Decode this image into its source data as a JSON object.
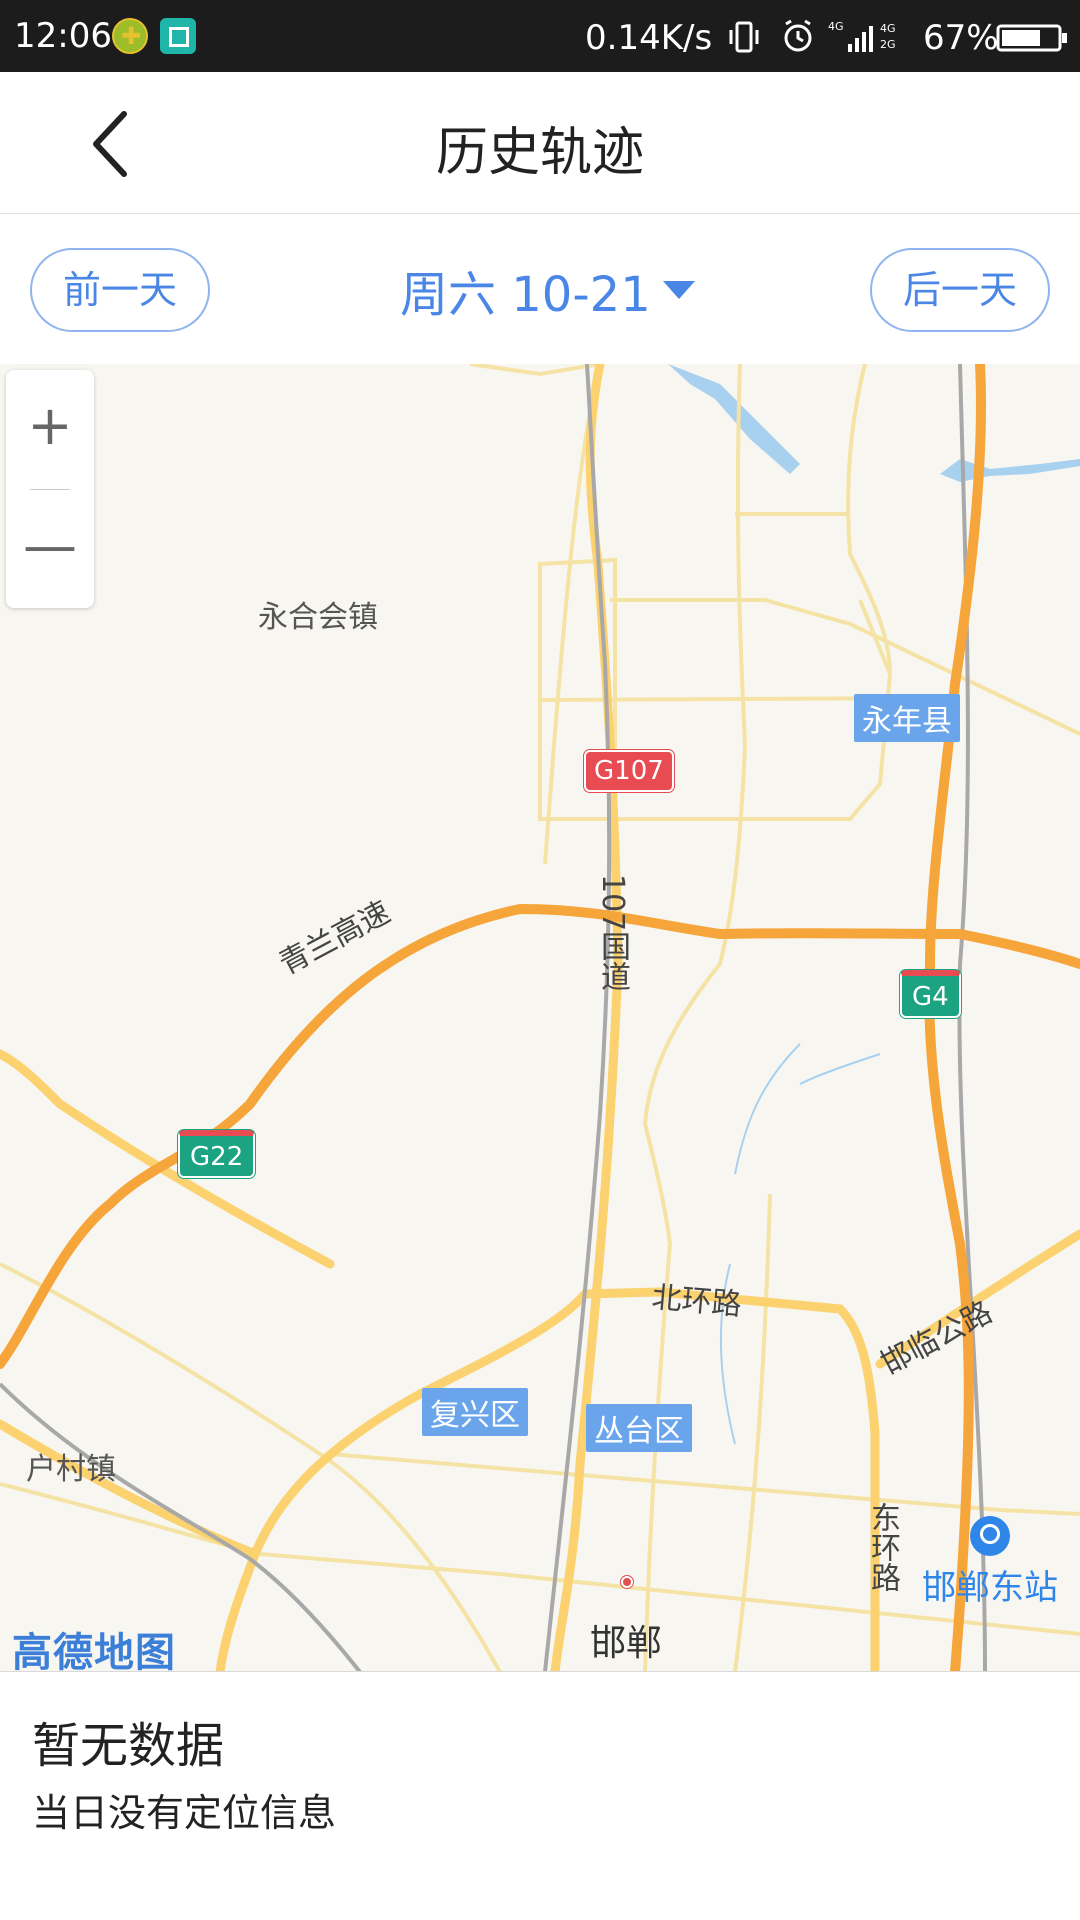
{
  "status_bar": {
    "time": "12:06",
    "net_speed": "0.14K/s",
    "battery": "67%",
    "icons": [
      "app-badge-icon",
      "scan-icon",
      "vibrate-icon",
      "alarm-icon",
      "signal-icon",
      "battery-icon"
    ]
  },
  "header": {
    "title": "历史轨迹",
    "back_icon": "chevron-left-icon"
  },
  "datebar": {
    "prev_label": "前一天",
    "next_label": "后一天",
    "date_label": "周六 10-21",
    "accent_color": "#4a86e6"
  },
  "map": {
    "zoom_in": "+",
    "zoom_out": "—",
    "places": {
      "yonghe": "永合会镇",
      "hucun": "户村镇",
      "handan": "邯郸"
    },
    "districts": {
      "yongnian": "永年县",
      "fuxing": "复兴区",
      "congtai": "丛台区"
    },
    "shields": {
      "g107": "G107",
      "g4": "G4",
      "g22": "G22"
    },
    "roads": {
      "national107": "107国道",
      "qinglan": "青兰高速",
      "beihuan": "北环路",
      "hanlin": "邯临公路",
      "donghuan": "东环路"
    },
    "station": "邯郸东站",
    "logo": "高德地图"
  },
  "empty_state": {
    "title": "暂无数据",
    "subtitle": "当日没有定位信息"
  }
}
